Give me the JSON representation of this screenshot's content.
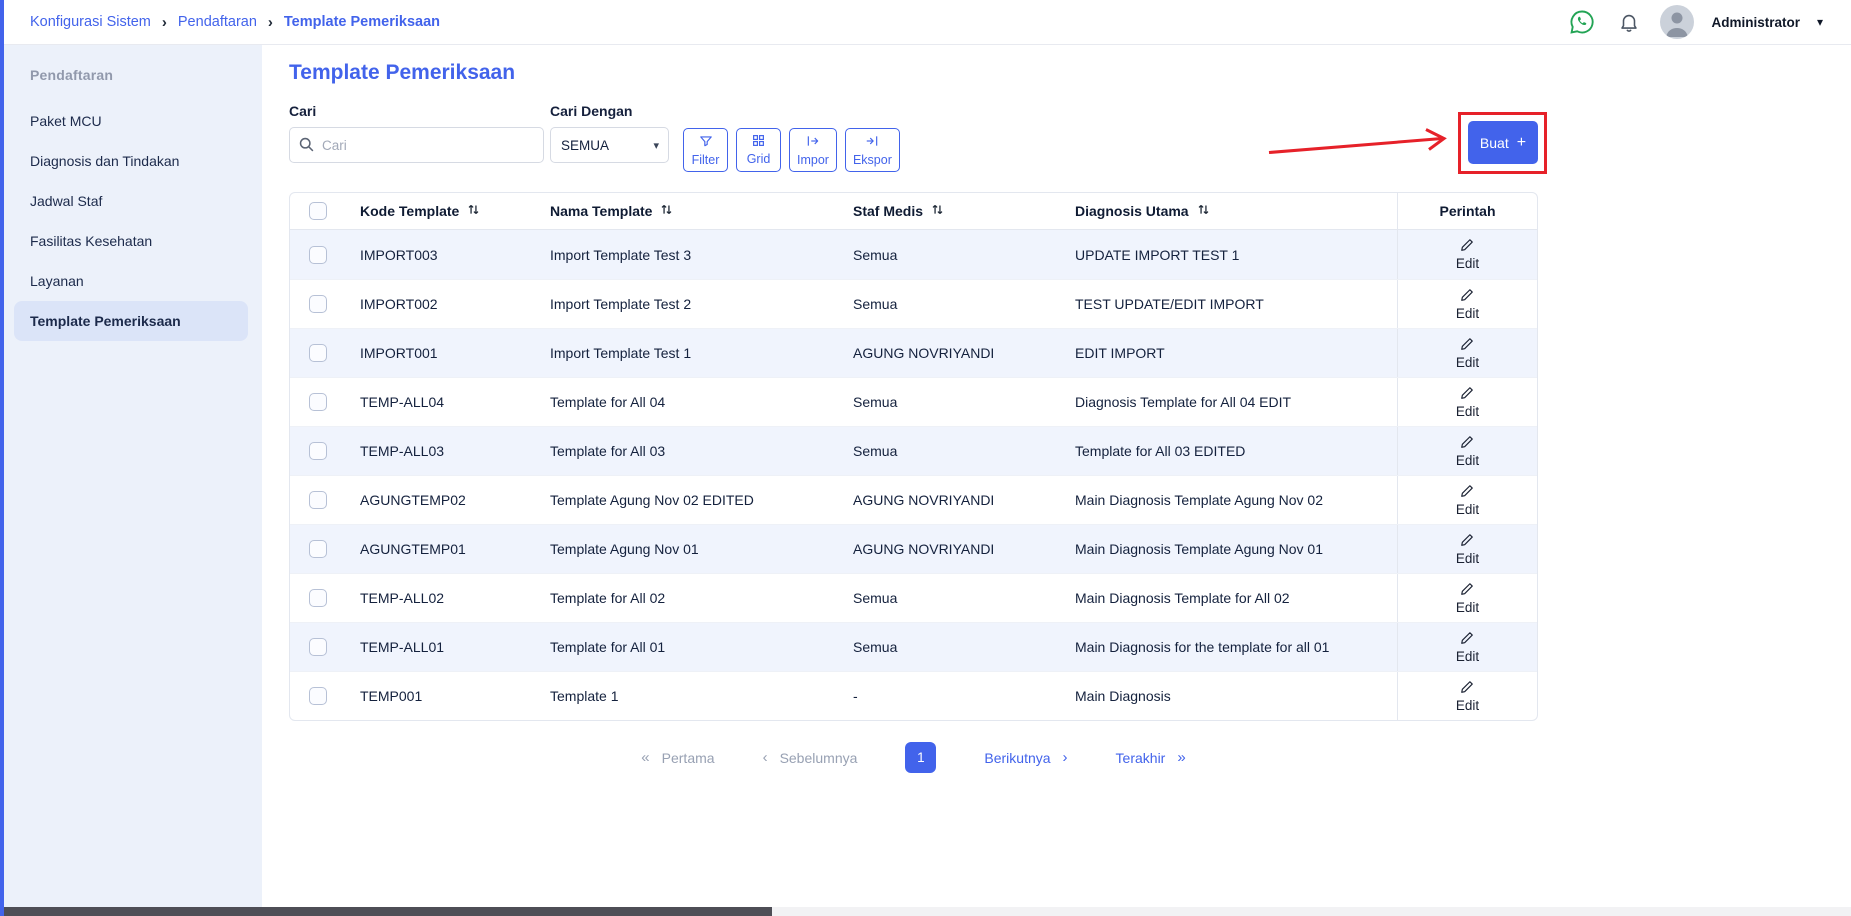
{
  "header": {
    "breadcrumb": [
      "Konfigurasi Sistem",
      "Pendaftaran",
      "Template Pemeriksaan"
    ],
    "user_name": "Administrator"
  },
  "sidebar": {
    "section_title": "Pendaftaran",
    "items": [
      {
        "label": "Paket MCU",
        "active": false
      },
      {
        "label": "Diagnosis dan Tindakan",
        "active": false
      },
      {
        "label": "Jadwal Staf",
        "active": false
      },
      {
        "label": "Fasilitas Kesehatan",
        "active": false
      },
      {
        "label": "Layanan",
        "active": false
      },
      {
        "label": "Template Pemeriksaan",
        "active": true
      }
    ]
  },
  "main": {
    "title": "Template Pemeriksaan",
    "search_label": "Cari",
    "search_placeholder": "Cari",
    "search_with_label": "Cari Dengan",
    "search_with_value": "SEMUA",
    "buttons": {
      "filter": "Filter",
      "grid": "Grid",
      "impor": "Impor",
      "ekspor": "Ekspor",
      "create": "Buat"
    },
    "table": {
      "columns": [
        {
          "label": "Kode Template",
          "sortable": true
        },
        {
          "label": "Nama Template",
          "sortable": true
        },
        {
          "label": "Staf Medis",
          "sortable": true
        },
        {
          "label": "Diagnosis Utama",
          "sortable": true
        },
        {
          "label": "Perintah",
          "sortable": false
        }
      ],
      "edit_label": "Edit",
      "rows": [
        {
          "kode": "IMPORT003",
          "nama": "Import Template Test 3",
          "staf": "Semua",
          "diagnosis": "UPDATE IMPORT TEST 1"
        },
        {
          "kode": "IMPORT002",
          "nama": "Import Template Test 2",
          "staf": "Semua",
          "diagnosis": "TEST UPDATE/EDIT IMPORT"
        },
        {
          "kode": "IMPORT001",
          "nama": "Import Template Test 1",
          "staf": "AGUNG NOVRIYANDI",
          "diagnosis": "EDIT IMPORT"
        },
        {
          "kode": "TEMP-ALL04",
          "nama": "Template for All 04",
          "staf": "Semua",
          "diagnosis": "Diagnosis Template for All 04 EDIT"
        },
        {
          "kode": "TEMP-ALL03",
          "nama": "Template for All 03",
          "staf": "Semua",
          "diagnosis": "Template for All 03 EDITED"
        },
        {
          "kode": "AGUNGTEMP02",
          "nama": "Template Agung Nov 02 EDITED",
          "staf": "AGUNG NOVRIYANDI",
          "diagnosis": "Main Diagnosis Template Agung Nov 02"
        },
        {
          "kode": "AGUNGTEMP01",
          "nama": "Template Agung Nov 01",
          "staf": "AGUNG NOVRIYANDI",
          "diagnosis": "Main Diagnosis Template Agung Nov 01"
        },
        {
          "kode": "TEMP-ALL02",
          "nama": "Template for All 02",
          "staf": "Semua",
          "diagnosis": "Main Diagnosis Template for All 02"
        },
        {
          "kode": "TEMP-ALL01",
          "nama": "Template for All 01",
          "staf": "Semua",
          "diagnosis": "Main Diagnosis for the template for all 01"
        },
        {
          "kode": "TEMP001",
          "nama": "Template 1",
          "staf": "-",
          "diagnosis": "Main Diagnosis"
        }
      ]
    },
    "pagination": {
      "first": "Pertama",
      "prev": "Sebelumnya",
      "current": "1",
      "next": "Berikutnya",
      "last": "Terakhir"
    }
  },
  "colors": {
    "primary": "#4263EB",
    "annotation_red": "#E62129",
    "row_alt": "#F0F4FD",
    "sidebar_bg": "#ECF1FA"
  }
}
